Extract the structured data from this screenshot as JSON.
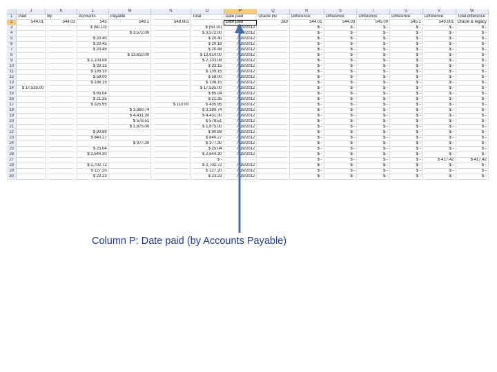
{
  "sheet": {
    "columns": [
      "",
      "J",
      "K",
      "L",
      "M",
      "N",
      "O",
      "P",
      "Q",
      "R",
      "S",
      "T",
      "U",
      "V",
      "W"
    ],
    "active_column": "P",
    "active_row": "2",
    "rows": [
      {
        "r": "1",
        "c": [
          "Paid",
          "By",
          "Accounts",
          "Payable",
          "",
          "Total",
          "Date paid",
          "Oracle inv",
          "Difference",
          "Difference",
          "Difference",
          "Difference",
          "Difference",
          "Total difference"
        ]
      },
      {
        "r": "2",
        "c": [
          "544.01",
          "544.03",
          "545",
          "548.1",
          "548.001",
          "",
          "Date paid",
          "283",
          "544.01",
          "544.03",
          "545.00",
          "545.1",
          "549.001",
          "Oracle & legacy"
        ]
      },
      {
        "r": "3",
        "c": [
          "",
          "",
          "$ (50.10)",
          "",
          "",
          "$ (50.10)",
          "7/19/2012",
          "",
          "$ -",
          "$ -",
          "$ -",
          "$ -",
          "$ -",
          "$ -"
        ]
      },
      {
        "r": "4",
        "c": [
          "",
          "",
          "",
          "$ 3,572.00",
          "",
          "$ 3,572.00",
          "7/19/2012",
          "",
          "$ -",
          "$ -",
          "$ -",
          "$ -",
          "$ -",
          "$ -"
        ]
      },
      {
        "r": "5",
        "c": [
          "",
          "",
          "$ 20.40",
          "",
          "",
          "$ 20.40",
          "7/19/2012",
          "",
          "$ -",
          "$ -",
          "$ -",
          "$ -",
          "$ -",
          "$ -"
        ]
      },
      {
        "r": "6",
        "c": [
          "",
          "",
          "$ 20.45",
          "",
          "",
          "$ 20.18",
          "7/19/2012",
          "",
          "$ -",
          "$ -",
          "$ -",
          "$ -",
          "$ -",
          "$ -"
        ]
      },
      {
        "r": "7",
        "c": [
          "",
          "",
          "$ 20.45",
          "",
          "",
          "$ 20.48",
          "7/19/2012",
          "",
          "$ -",
          "$ -",
          "$ -",
          "$ -",
          "$ -",
          "$ -"
        ]
      },
      {
        "r": "8",
        "c": [
          "",
          "",
          "",
          "$ 13,610.00",
          "",
          "$ 13,610.00",
          "7/19/2012",
          "",
          "$ -",
          "$ -",
          "$ -",
          "$ -",
          "$ -",
          "$ -"
        ]
      },
      {
        "r": "9",
        "c": [
          "",
          "",
          "$ 2,103.08",
          "",
          "",
          "$ 2,103.08",
          "7/19/2012",
          "",
          "$ -",
          "$ -",
          "$ -",
          "$ -",
          "$ -",
          "$ -"
        ]
      },
      {
        "r": "10",
        "c": [
          "",
          "",
          "$ 33.15",
          "",
          "",
          "$ 33.15",
          "7/19/2012",
          "",
          "$ -",
          "$ -",
          "$ -",
          "$ -",
          "$ -",
          "$ -"
        ]
      },
      {
        "r": "11",
        "c": [
          "",
          "",
          "$ 135.15",
          "",
          "",
          "$ 135.15",
          "7/19/2012",
          "",
          "$ -",
          "$ -",
          "$ -",
          "$ -",
          "$ -",
          "$ -"
        ]
      },
      {
        "r": "12",
        "c": [
          "",
          "",
          "$ 58.00",
          "",
          "",
          "$ 58.00",
          "7/19/2012",
          "",
          "$ -",
          "$ -",
          "$ -",
          "$ -",
          "$ -",
          "$ -"
        ]
      },
      {
        "r": "13",
        "c": [
          "",
          "",
          "$ 136.15",
          "",
          "",
          "$ 136.15",
          "7/19/2012",
          "",
          "$ -",
          "$ -",
          "$ -",
          "$ -",
          "$ -",
          "$ -"
        ]
      },
      {
        "r": "14",
        "c": [
          "$ 17,535.00",
          "",
          "",
          "",
          "",
          "$ 17,535.00",
          "7/19/2012",
          "",
          "$ -",
          "$ -",
          "$ -",
          "$ -",
          "$ -",
          "$ -"
        ]
      },
      {
        "r": "15",
        "c": [
          "",
          "",
          "$ 65.04",
          "",
          "",
          "$ 65.04",
          "7/19/2012",
          "",
          "$ -",
          "$ -",
          "$ -",
          "$ -",
          "$ -",
          "$ -"
        ]
      },
      {
        "r": "16",
        "c": [
          "",
          "",
          "$ 21.35",
          "",
          "",
          "$ 21.35",
          "7/19/2012",
          "",
          "$ -",
          "$ -",
          "$ -",
          "$ -",
          "$ -",
          "$ -"
        ]
      },
      {
        "r": "17",
        "c": [
          "",
          "",
          "$ 325.95",
          "",
          "$ 110.00",
          "$ 435.95",
          "7/19/2012",
          "",
          "$ -",
          "$ -",
          "$ -",
          "$ -",
          "$ -",
          "$ -"
        ]
      },
      {
        "r": "18",
        "c": [
          "",
          "",
          "",
          "$ 3,380.74",
          "",
          "$ 3,380.74",
          "7/19/2012",
          "",
          "$ -",
          "$ -",
          "$ -",
          "$ -",
          "$ -",
          "$ -"
        ]
      },
      {
        "r": "19",
        "c": [
          "",
          "",
          "",
          "$ 4,431.30",
          "",
          "$ 4,431.30",
          "7/19/2012",
          "",
          "$ -",
          "$ -",
          "$ -",
          "$ -",
          "$ -",
          "$ -"
        ]
      },
      {
        "r": "20",
        "c": [
          "",
          "",
          "",
          "$ 578.51",
          "",
          "$ 578.51",
          "7/19/2012",
          "",
          "$ -",
          "$ -",
          "$ -",
          "$ -",
          "$ -",
          "$ -"
        ]
      },
      {
        "r": "21",
        "c": [
          "",
          "",
          "",
          "$ 1,875.00",
          "",
          "$ 1,875.00",
          "7/19/2012",
          "",
          "$ -",
          "$ -",
          "$ -",
          "$ -",
          "$ -",
          "$ -"
        ]
      },
      {
        "r": "22",
        "c": [
          "",
          "",
          "$ 90.89",
          "",
          "",
          "$ 90.89",
          "7/19/2012",
          "",
          "$ -",
          "$ -",
          "$ -",
          "$ -",
          "$ -",
          "$ -"
        ]
      },
      {
        "r": "23",
        "c": [
          "",
          "",
          "$ 840.27",
          "",
          "",
          "$ 840.27",
          "7/19/2012",
          "",
          "$ -",
          "$ -",
          "$ -",
          "$ -",
          "$ -",
          "$ -"
        ]
      },
      {
        "r": "24",
        "c": [
          "",
          "",
          "",
          "$ 377.30",
          "",
          "$ 377.30",
          "7/19/2012",
          "",
          "$ -",
          "$ -",
          "$ -",
          "$ -",
          "$ -",
          "$ -"
        ]
      },
      {
        "r": "25",
        "c": [
          "",
          "",
          "$ 25.04",
          "",
          "",
          "$ 25.04",
          "7/19/2012",
          "",
          "$ -",
          "$ -",
          "$ -",
          "$ -",
          "$ -",
          "$ -"
        ]
      },
      {
        "r": "26",
        "c": [
          "",
          "",
          "$ 2,644.30",
          "",
          "",
          "$ 2,644.30",
          "7/19/2012",
          "",
          "$ -",
          "$ -",
          "$ -",
          "$ -",
          "$ -",
          "$ -"
        ]
      },
      {
        "r": "27",
        "c": [
          "",
          "",
          "",
          "",
          "",
          "$ -",
          "",
          "",
          "$ -",
          "$ -",
          "$ -",
          "$ -",
          "$ 417.42",
          "$ 417.42"
        ]
      },
      {
        "r": "28",
        "c": [
          "",
          "",
          "$ 2,702.72",
          "",
          "",
          "$ 2,702.72",
          "7/19/2012",
          "",
          "$ -",
          "$ -",
          "$ -",
          "$ -",
          "$ -",
          "$ -"
        ]
      },
      {
        "r": "29",
        "c": [
          "",
          "",
          "$ 127.20",
          "",
          "",
          "$ 127.20",
          "7/19/2012",
          "",
          "$ -",
          "$ -",
          "$ -",
          "$ -",
          "$ -",
          "$ -"
        ]
      },
      {
        "r": "30",
        "c": [
          "",
          "",
          "$ 23.23",
          "",
          "",
          "$ 23.23",
          "7/19/2012",
          "",
          "$ -",
          "$ -",
          "$ -",
          "$ -",
          "$ -",
          "$ -"
        ]
      }
    ]
  },
  "annotation": {
    "caption": "Column P:  Date paid (by Accounts Payable)",
    "color": "#4a6fa5"
  }
}
